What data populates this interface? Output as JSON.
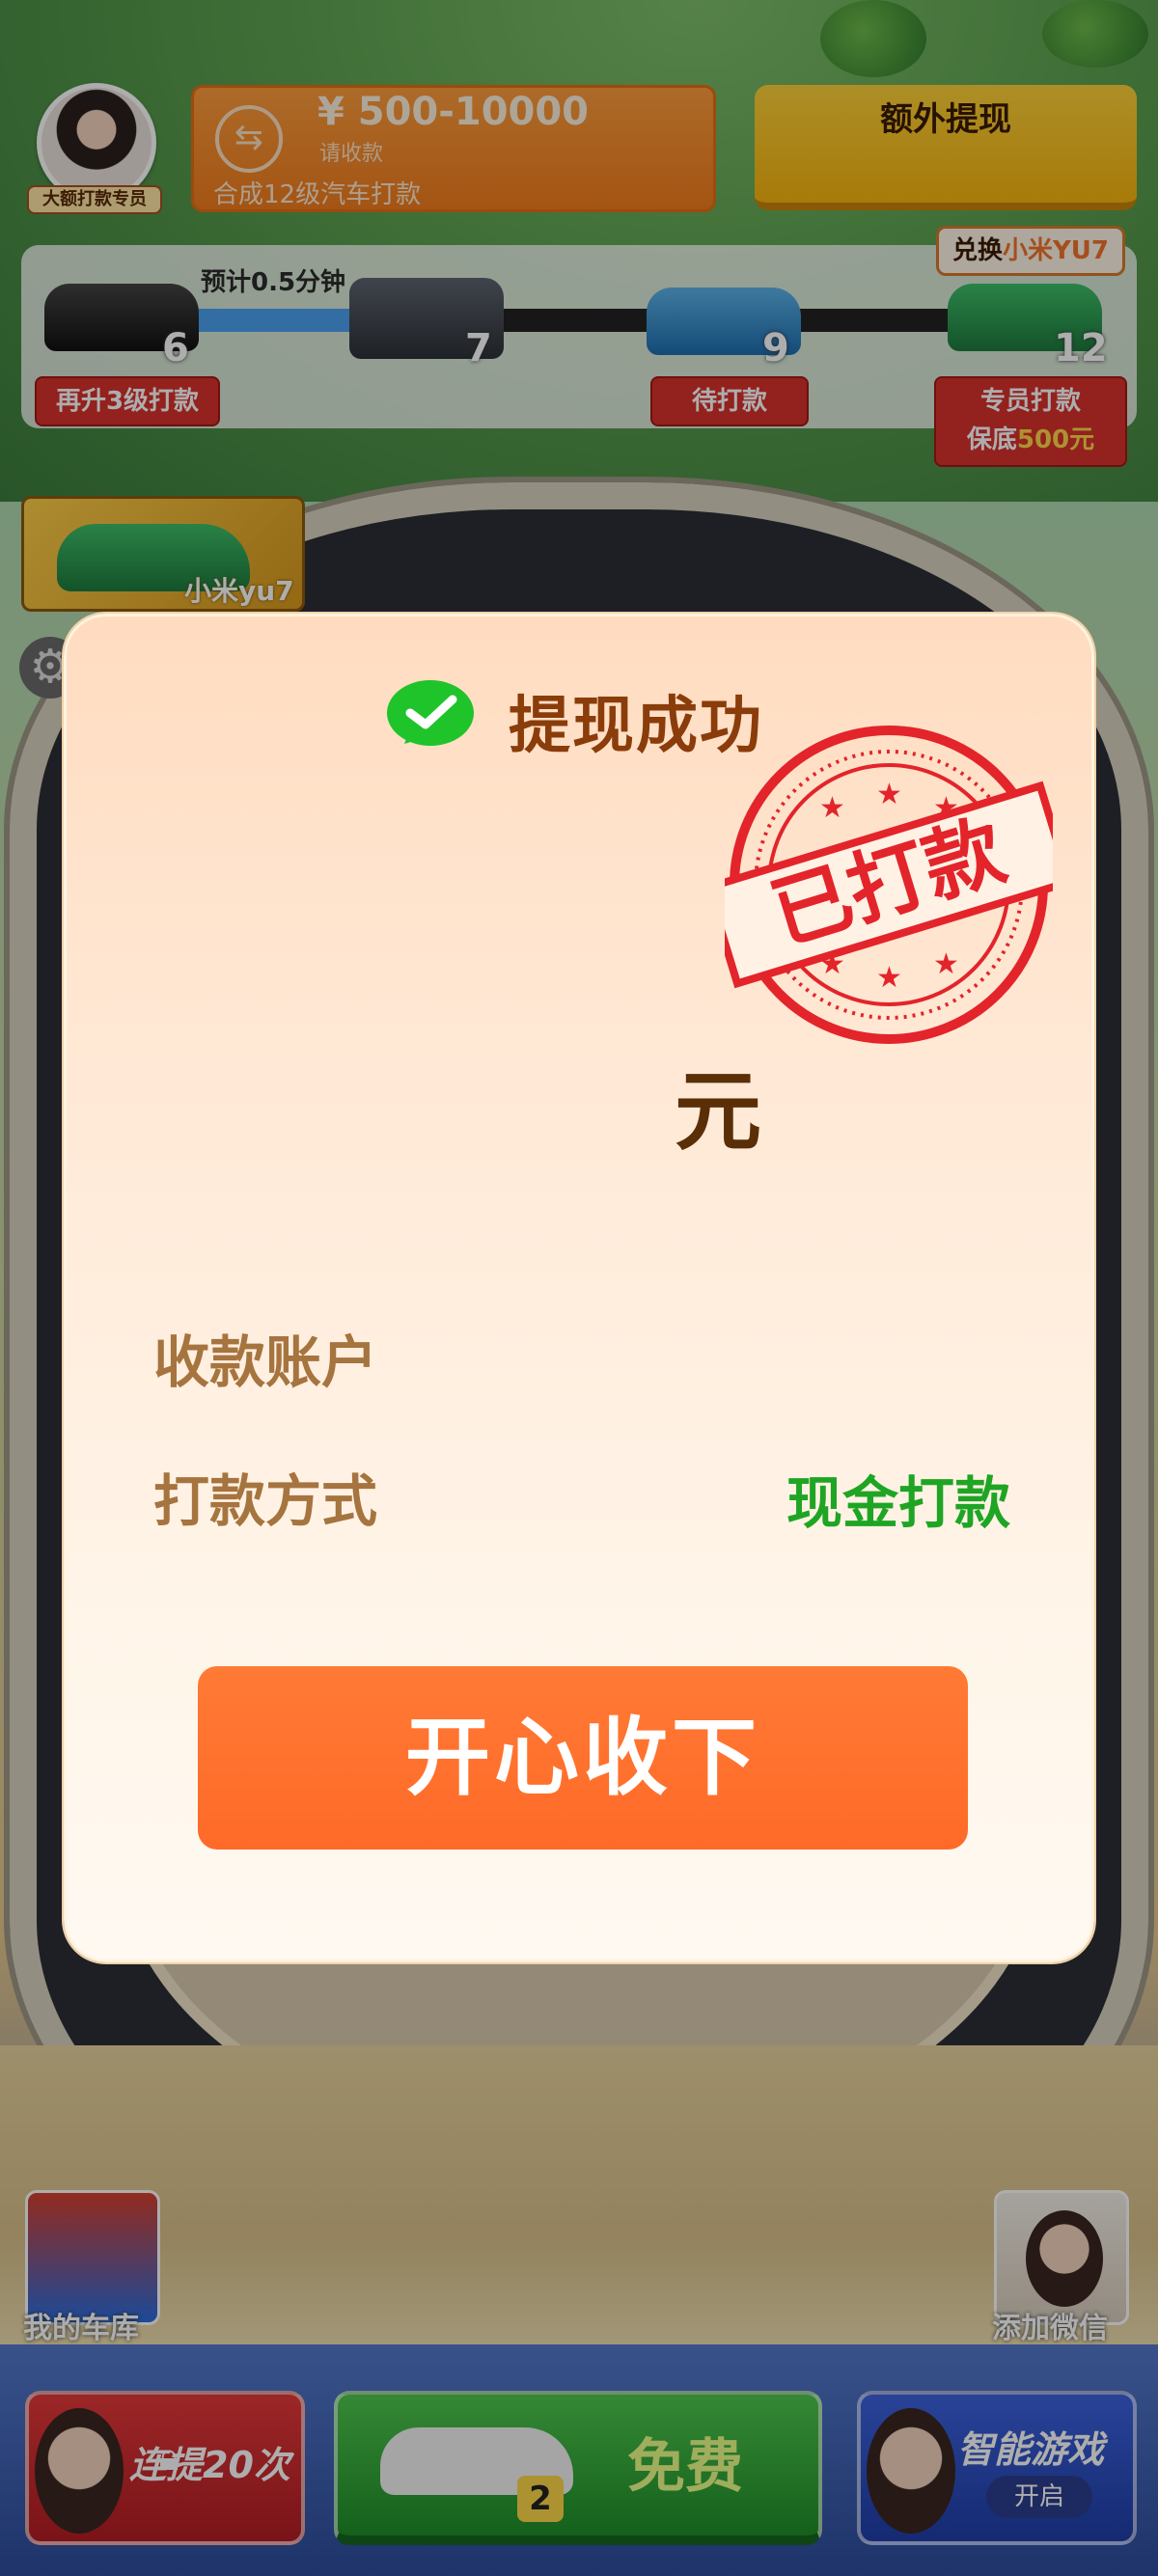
{
  "hud": {
    "agent_label": "大额打款专员",
    "prize_icon": "⇆",
    "prize_amount": "¥ 500-10000",
    "prize_sub": "请收款",
    "prize_desc": "合成12级汽车打款",
    "extra_withdraw": "额外提现",
    "eta": "预计0.5分钟",
    "progress": 0.24,
    "exchange_prefix": "兑换",
    "exchange_highlight": "小米YU7",
    "featured_car_label": "小米yu7"
  },
  "stages": [
    {
      "level": "6",
      "label": "再升3级打款"
    },
    {
      "level": "7",
      "label": ""
    },
    {
      "level": "9",
      "label": "待打款"
    },
    {
      "level": "12",
      "label_line1": "专员打款",
      "label_line2_prefix": "保底",
      "label_line2_highlight": "500元"
    }
  ],
  "modal": {
    "title": "提现成功",
    "stamp_text": "已打款",
    "amount_unit": "元",
    "account_label": "收款账户",
    "method_label": "打款方式",
    "method_value": "现金打款",
    "confirm_label": "开心收下"
  },
  "bottom": {
    "garage_label": "我的车库",
    "wechat_label": "添加微信",
    "remind_label": "连提20次",
    "free_label": "免费",
    "free_count": "2",
    "game_label": "智能游戏",
    "game_open": "开启"
  },
  "colors": {
    "accent_orange": "#ff6a28",
    "success_green": "#1fa524",
    "stamp_red": "#e3242b",
    "title_brown": "#8a3c0a"
  }
}
